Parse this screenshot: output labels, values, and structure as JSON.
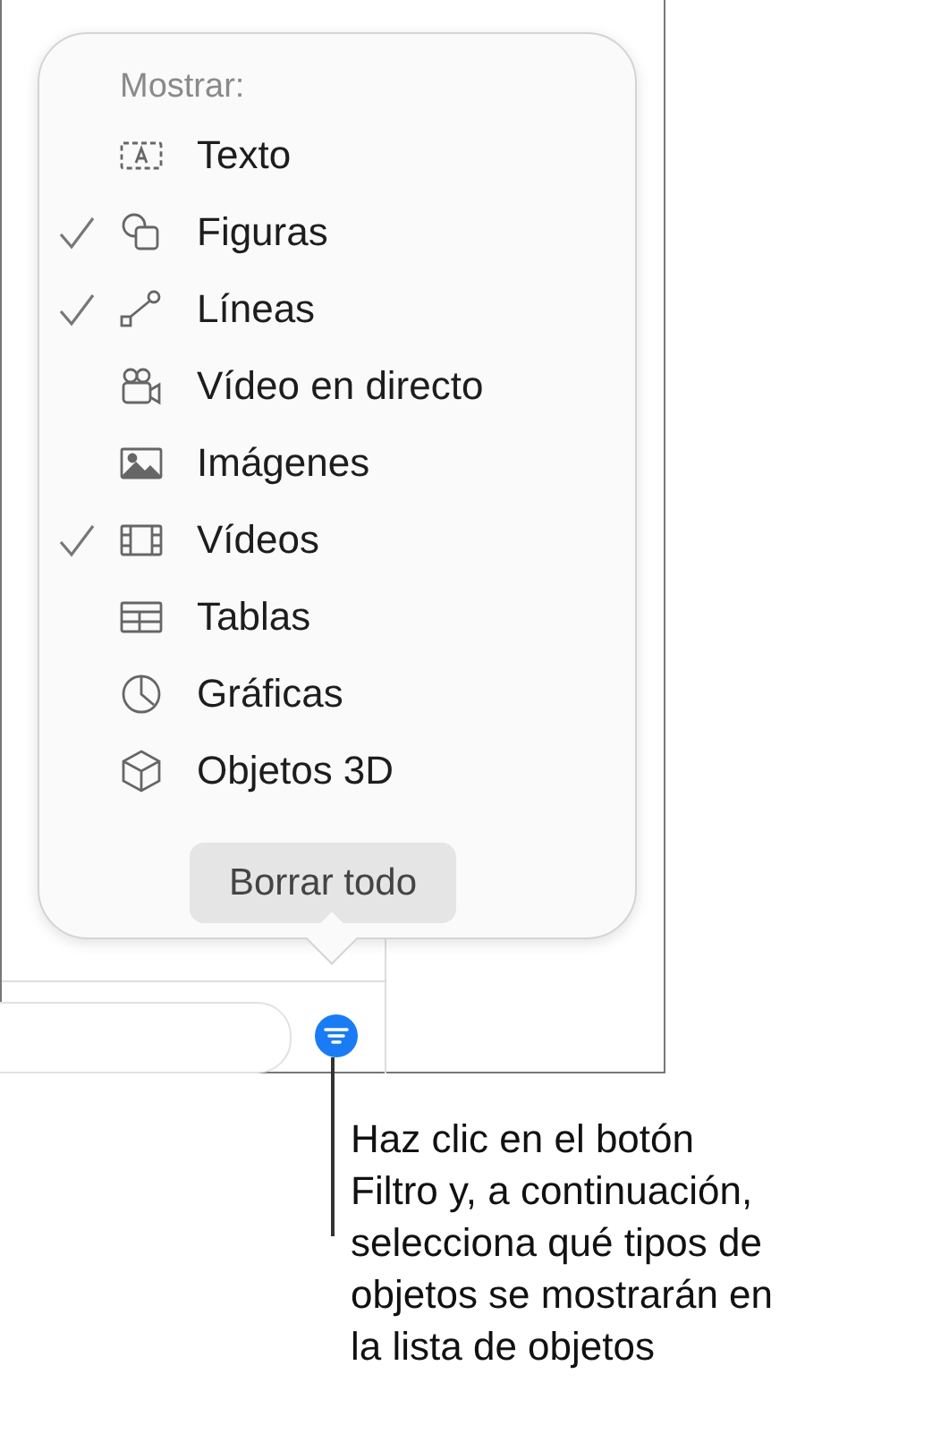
{
  "popover": {
    "header": "Mostrar:",
    "items": [
      {
        "label": "Texto",
        "kind": "text",
        "checked": false
      },
      {
        "label": "Figuras",
        "kind": "shapes",
        "checked": true
      },
      {
        "label": "Líneas",
        "kind": "lines",
        "checked": true
      },
      {
        "label": "Vídeo en directo",
        "kind": "live-video",
        "checked": false
      },
      {
        "label": "Imágenes",
        "kind": "images",
        "checked": false
      },
      {
        "label": "Vídeos",
        "kind": "videos",
        "checked": true
      },
      {
        "label": "Tablas",
        "kind": "tables",
        "checked": false
      },
      {
        "label": "Gráficas",
        "kind": "charts",
        "checked": false
      },
      {
        "label": "Objetos 3D",
        "kind": "objects-3d",
        "checked": false
      }
    ],
    "button": "Borrar todo"
  },
  "callout": "Haz clic en el botón Filtro y, a continuación, selecciona qué tipos de objetos se mostrarán en la lista de objetos"
}
